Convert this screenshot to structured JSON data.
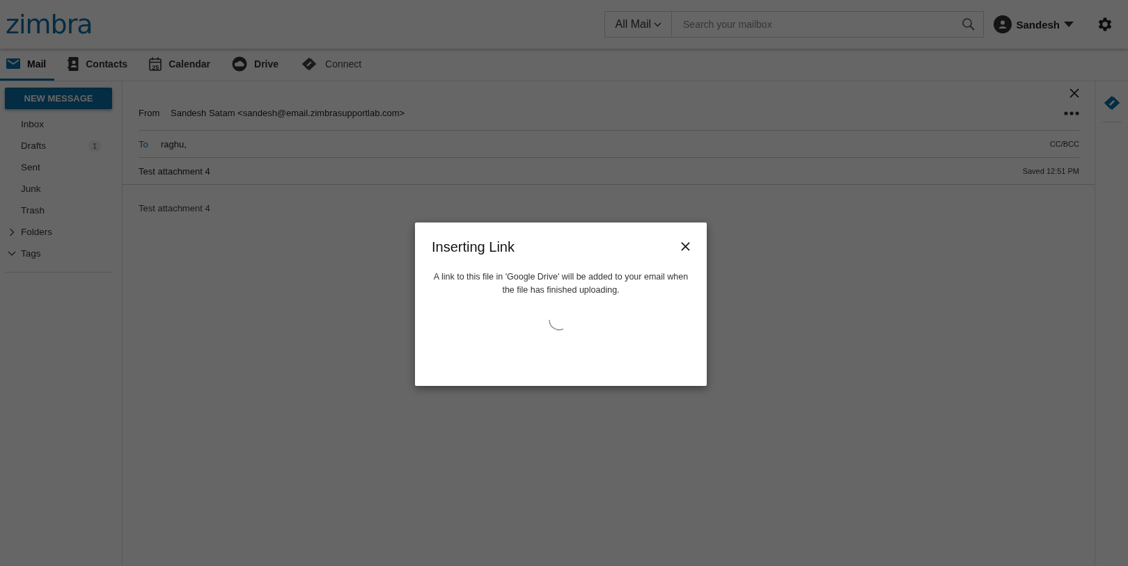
{
  "header": {
    "logo": "zimbra",
    "search": {
      "scope": "All Mail",
      "placeholder": "Search your mailbox"
    },
    "user": "Sandesh"
  },
  "nav_tabs": [
    {
      "label": "Mail",
      "selected": true,
      "kind": "mail"
    },
    {
      "label": "Contacts",
      "selected": false,
      "kind": "contacts"
    },
    {
      "label": "Calendar",
      "selected": false,
      "kind": "calendar",
      "icon_text": "25"
    },
    {
      "label": "Drive",
      "selected": false,
      "kind": "drive"
    },
    {
      "label": "Connect",
      "selected": false,
      "kind": "connect"
    }
  ],
  "sidebar": {
    "new_message": "NEW MESSAGE",
    "folders": [
      {
        "label": "Inbox"
      },
      {
        "label": "Drafts",
        "count": "1"
      },
      {
        "label": "Sent"
      },
      {
        "label": "Junk"
      },
      {
        "label": "Trash"
      }
    ],
    "groups": [
      {
        "label": "Folders",
        "expanded": false
      },
      {
        "label": "Tags",
        "expanded": true
      }
    ]
  },
  "compose": {
    "from_label": "From",
    "from": "Sandesh Satam <sandesh@email.zimbrasupportlab.com>",
    "to_label": "To",
    "to": "raghu,",
    "cc_bcc": "CC/BCC",
    "subject": "Test attachment 4",
    "saved": "Saved 12:51 PM",
    "body": "Test attachment 4"
  },
  "dialog": {
    "title": "Inserting Link",
    "message": "A link to this file in 'Google Drive' will be added to your email when the file has finished uploading."
  }
}
